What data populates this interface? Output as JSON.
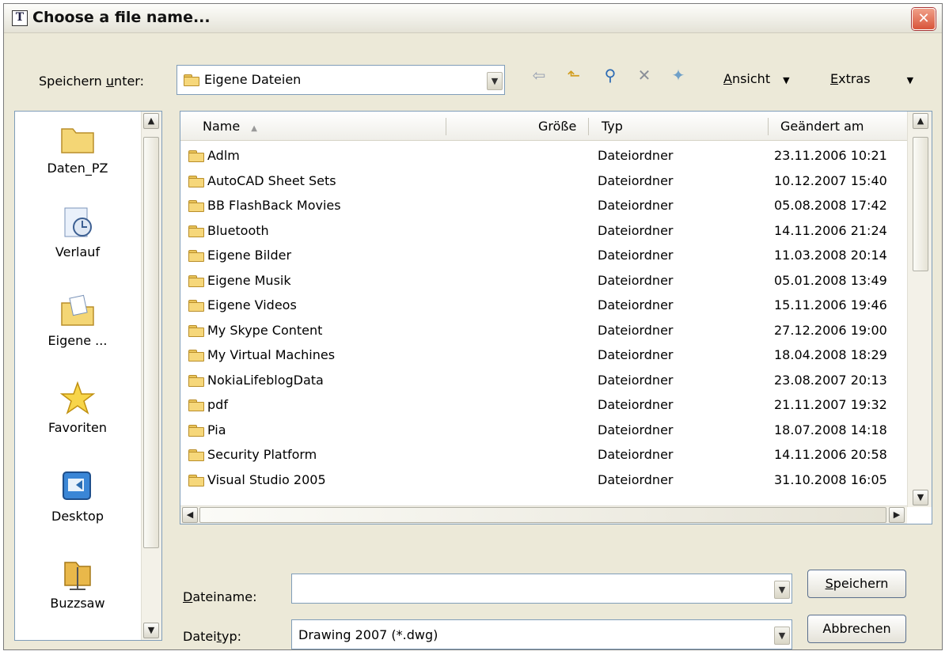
{
  "window": {
    "title": "Choose a file name...",
    "app_icon": "T"
  },
  "top": {
    "save_in_label_pre": "Speichern ",
    "save_in_label_u": "u",
    "save_in_label_post": "nter:",
    "location": "Eigene Dateien",
    "view_u": "A",
    "view_rest": "nsicht",
    "extras_u": "E",
    "extras_rest": "xtras"
  },
  "places": [
    {
      "label": "Daten_PZ",
      "icon": "folder-icon"
    },
    {
      "label": "Verlauf",
      "icon": "history-icon"
    },
    {
      "label": "Eigene ...",
      "icon": "my-documents-icon"
    },
    {
      "label": "Favoriten",
      "icon": "star-icon"
    },
    {
      "label": "Desktop",
      "icon": "desktop-icon"
    },
    {
      "label": "Buzzsaw",
      "icon": "buzzsaw-icon"
    }
  ],
  "columns": {
    "name": "Name",
    "size": "Größe",
    "type": "Typ",
    "modified": "Geändert am"
  },
  "files": [
    {
      "name": "Adlm",
      "type": "Dateiordner",
      "modified": "23.11.2006 10:21",
      "icon": "folder-icon"
    },
    {
      "name": "AutoCAD Sheet Sets",
      "type": "Dateiordner",
      "modified": "10.12.2007 15:40",
      "icon": "folder-icon"
    },
    {
      "name": "BB FlashBack Movies",
      "type": "Dateiordner",
      "modified": "05.08.2008 17:42",
      "icon": "folder-icon"
    },
    {
      "name": "Bluetooth",
      "type": "Dateiordner",
      "modified": "14.11.2006 21:24",
      "icon": "folder-icon"
    },
    {
      "name": "Eigene Bilder",
      "type": "Dateiordner",
      "modified": "11.03.2008 20:14",
      "icon": "pictures-folder-icon"
    },
    {
      "name": "Eigene Musik",
      "type": "Dateiordner",
      "modified": "05.01.2008 13:49",
      "icon": "music-folder-icon"
    },
    {
      "name": "Eigene Videos",
      "type": "Dateiordner",
      "modified": "15.11.2006 19:46",
      "icon": "videos-folder-icon"
    },
    {
      "name": "My Skype Content",
      "type": "Dateiordner",
      "modified": "27.12.2006 19:00",
      "icon": "folder-icon"
    },
    {
      "name": "My Virtual Machines",
      "type": "Dateiordner",
      "modified": "18.04.2008 18:29",
      "icon": "folder-icon"
    },
    {
      "name": "NokiaLifeblogData",
      "type": "Dateiordner",
      "modified": "23.08.2007 20:13",
      "icon": "folder-icon"
    },
    {
      "name": "pdf",
      "type": "Dateiordner",
      "modified": "21.11.2007 19:32",
      "icon": "folder-icon"
    },
    {
      "name": "Pia",
      "type": "Dateiordner",
      "modified": "18.07.2008 14:18",
      "icon": "folder-icon"
    },
    {
      "name": "Security Platform",
      "type": "Dateiordner",
      "modified": "14.11.2006 20:58",
      "icon": "folder-icon"
    },
    {
      "name": "Visual Studio 2005",
      "type": "Dateiordner",
      "modified": "31.10.2008 16:05",
      "icon": "folder-icon"
    }
  ],
  "bottom": {
    "filename_label_u": "D",
    "filename_label_rest": "ateiname:",
    "filename_value": "",
    "filetype_label_pre": "Datei",
    "filetype_label_u": "t",
    "filetype_label_post": "yp:",
    "filetype_value": "Drawing 2007 (*.dwg)",
    "save_u": "S",
    "save_rest": "peichern",
    "cancel": "Abbrechen"
  }
}
